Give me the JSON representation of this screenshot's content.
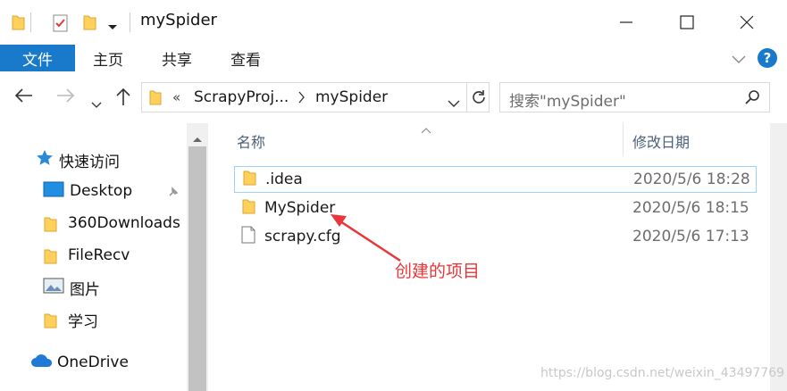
{
  "window": {
    "title": "mySpider",
    "buttons": {
      "minimize": "minimize-icon",
      "maximize": "maximize-icon",
      "close": "close-icon"
    }
  },
  "ribbon": {
    "tabs": [
      "文件",
      "主页",
      "共享",
      "查看"
    ],
    "help_label": "?"
  },
  "address": {
    "overflow": "«",
    "crumbs": [
      "ScrapyProj...",
      "mySpider"
    ],
    "search_placeholder": "搜索\"mySpider\""
  },
  "sidebar": {
    "quick_access": "快速访问",
    "items": [
      "Desktop",
      "360Downloads",
      "FileRecv",
      "图片",
      "学习"
    ],
    "onedrive": "OneDrive"
  },
  "files": {
    "columns": {
      "name": "名称",
      "modified": "修改日期"
    },
    "rows": [
      {
        "name": ".idea",
        "date": "2020/5/6 18:28",
        "icon": "folder-icon"
      },
      {
        "name": "MySpider",
        "date": "2020/5/6 18:15",
        "icon": "folder-icon"
      },
      {
        "name": "scrapy.cfg",
        "date": "2020/5/6 17:13",
        "icon": "file-icon"
      }
    ]
  },
  "annotation": {
    "text": "创建的项目",
    "color": "#e8373a"
  },
  "watermark": "https://blog.csdn.net/weixin_43497769",
  "colors": {
    "accent": "#1979ca",
    "folder": "#ffd15c",
    "selection_border": "#99d1ff"
  }
}
